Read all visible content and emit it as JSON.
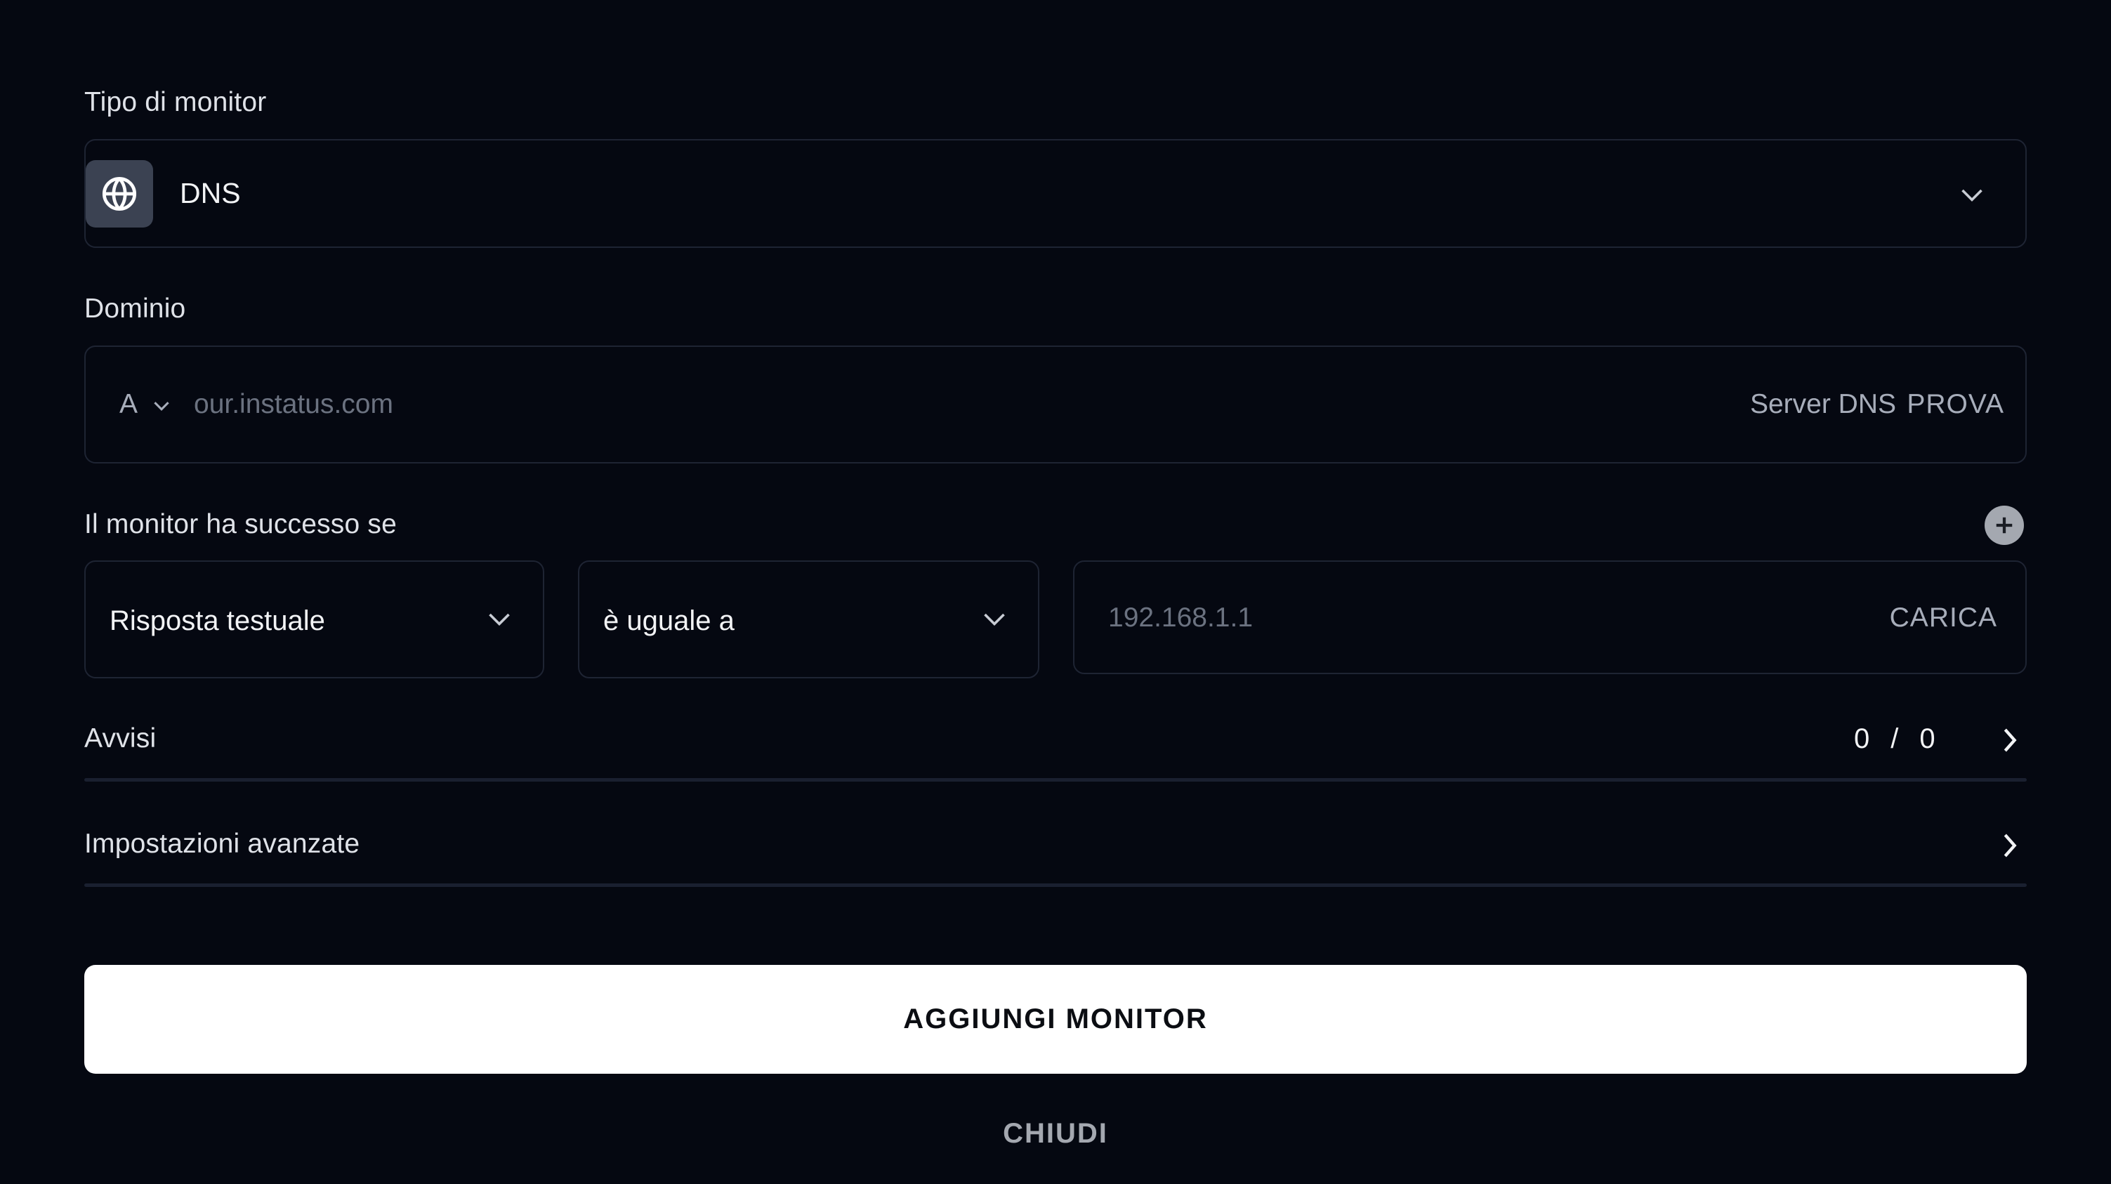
{
  "monitor_type": {
    "label": "Tipo di monitor",
    "value": "DNS",
    "icon": "globe-icon"
  },
  "domain": {
    "label": "Dominio",
    "record_type": "A",
    "placeholder": "our.instatus.com",
    "dns_server_label": "Server DNS",
    "test_label": "PROVA"
  },
  "success_condition": {
    "label": "Il monitor ha successo se",
    "field_value": "Risposta testuale",
    "operator_value": "è uguale a",
    "value_placeholder": "192.168.1.1",
    "upload_label": "CARICA"
  },
  "alerts": {
    "label": "Avvisi",
    "count_a": "0",
    "separator": "/",
    "count_b": "0"
  },
  "advanced": {
    "label": "Impostazioni avanzate"
  },
  "actions": {
    "submit_label": "AGGIUNGI MONITOR",
    "close_label": "CHIUDI"
  },
  "colors": {
    "background": "#050811",
    "border": "#1e2433",
    "primary_button": "#ffffff"
  }
}
